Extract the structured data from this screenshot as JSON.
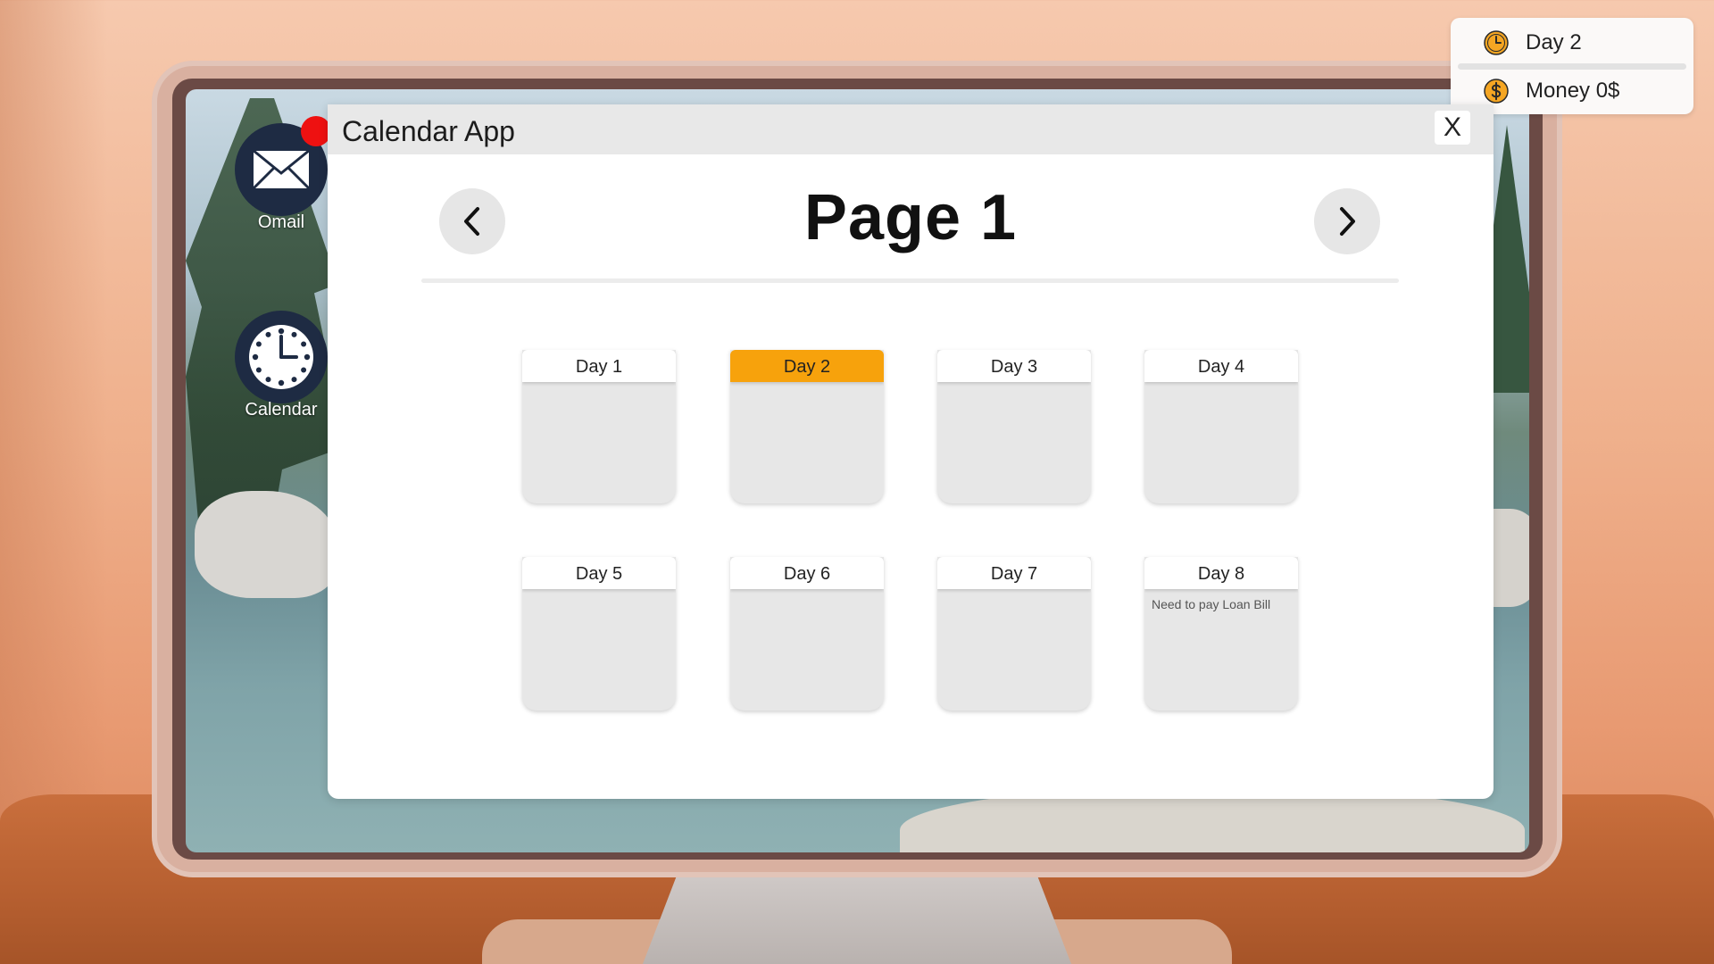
{
  "hud": {
    "day_label": "Day 2",
    "money_label": "Money 0$",
    "icon_color": "#f5a623"
  },
  "desktop": {
    "icons": [
      {
        "name": "omail",
        "label": "Omail",
        "icon": "envelope-icon",
        "has_notification": true
      },
      {
        "name": "calendar",
        "label": "Calendar",
        "icon": "clock-icon"
      }
    ]
  },
  "app": {
    "title": "Calendar App",
    "close_label": "X",
    "page_title": "Page 1",
    "prev_icon": "chevron-left-icon",
    "next_icon": "chevron-right-icon",
    "highlight_color": "#f7a20c",
    "current_day": "Day 2",
    "days": [
      {
        "label": "Day 1",
        "note": ""
      },
      {
        "label": "Day 2",
        "note": ""
      },
      {
        "label": "Day 3",
        "note": ""
      },
      {
        "label": "Day 4",
        "note": ""
      },
      {
        "label": "Day 5",
        "note": ""
      },
      {
        "label": "Day 6",
        "note": ""
      },
      {
        "label": "Day 7",
        "note": ""
      },
      {
        "label": "Day 8",
        "note": "Need to pay Loan Bill"
      }
    ]
  }
}
